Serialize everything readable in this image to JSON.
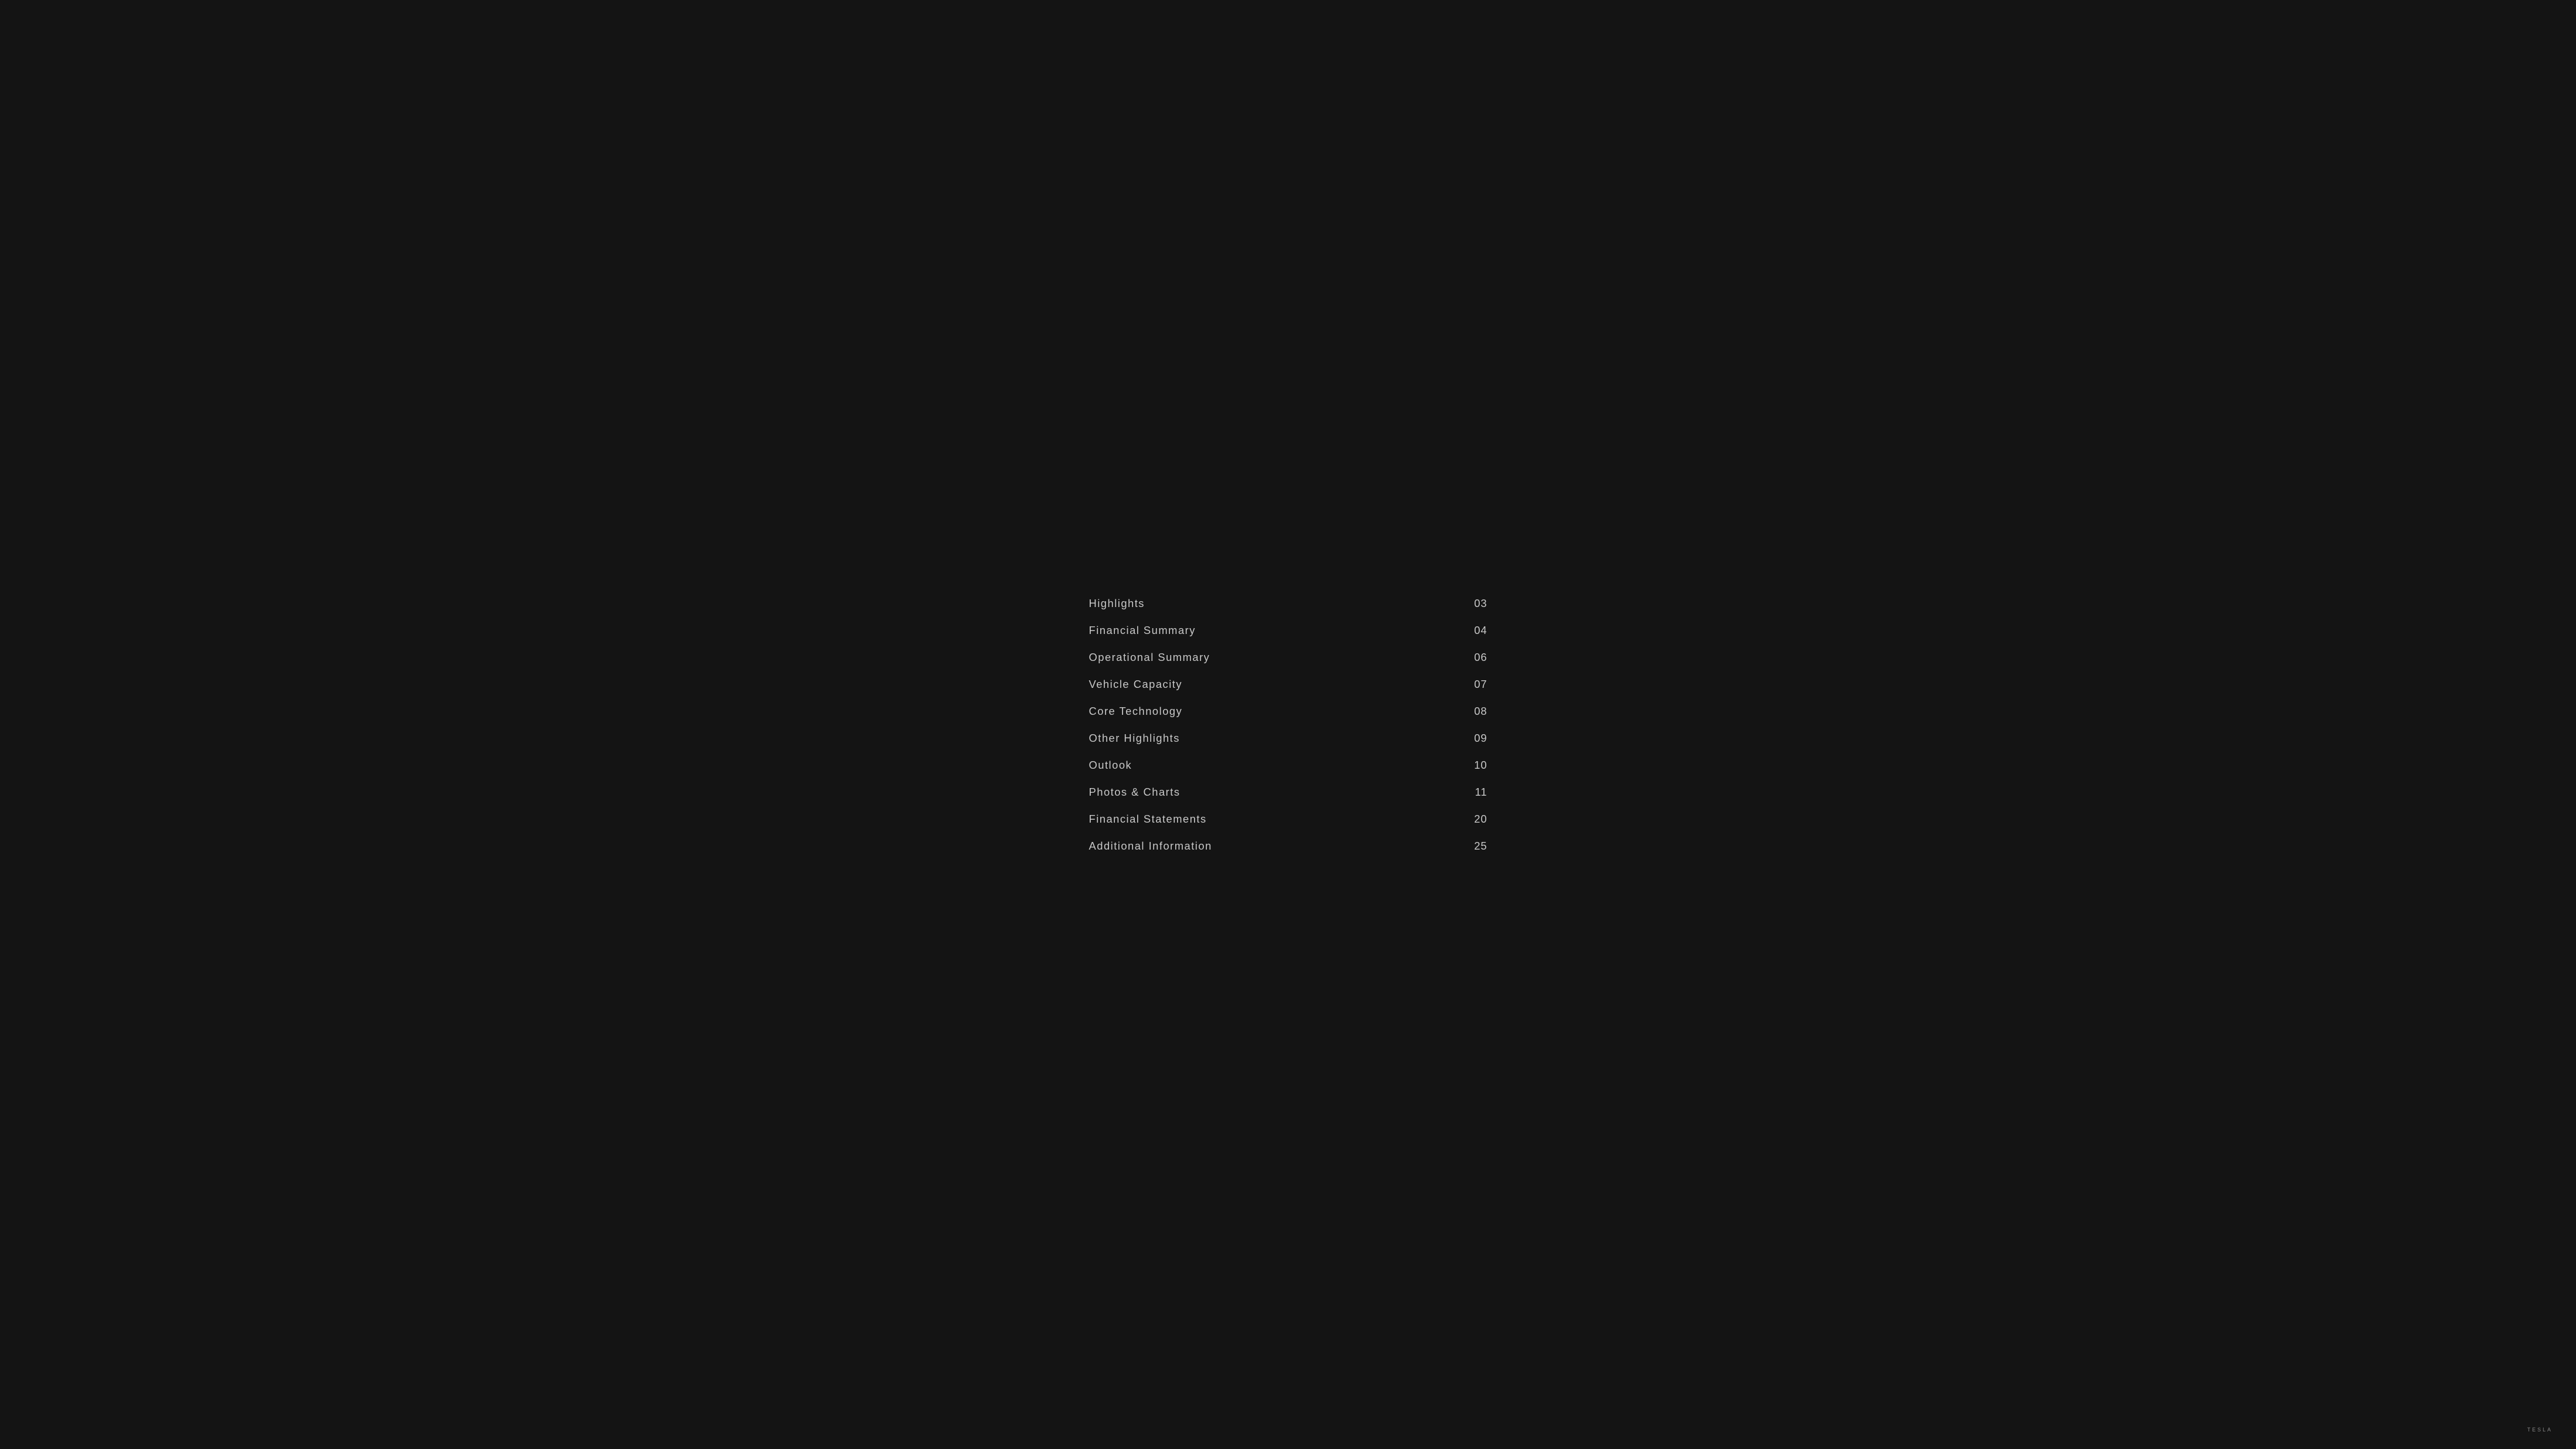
{
  "toc": {
    "items": [
      {
        "label": "Highlights",
        "page": "03"
      },
      {
        "label": "Financial Summary",
        "page": "04"
      },
      {
        "label": "Operational Summary",
        "page": "06"
      },
      {
        "label": "Vehicle Capacity",
        "page": "07"
      },
      {
        "label": "Core Technology",
        "page": "08"
      },
      {
        "label": "Other Highlights",
        "page": "09"
      },
      {
        "label": "Outlook",
        "page": "10"
      },
      {
        "label": "Photos & Charts",
        "page": "11"
      },
      {
        "label": "Financial Statements",
        "page": "20"
      },
      {
        "label": "Additional Information",
        "page": "25"
      }
    ]
  },
  "brand": {
    "logo_text": "TESLA"
  }
}
